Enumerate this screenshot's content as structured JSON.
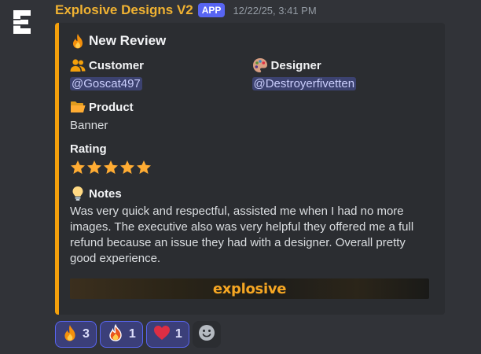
{
  "message": {
    "avatar_letter": "E",
    "author": "Explosive Designs V2",
    "app_tag": "APP",
    "timestamp": "12/22/25, 3:41 PM"
  },
  "embed": {
    "accent_color": "#f4a00b",
    "title": "New Review",
    "title_icon": "fire-icon",
    "fields": {
      "customer": {
        "label": "Customer",
        "icon": "people-icon",
        "value": "@Goscat497"
      },
      "designer": {
        "label": "Designer",
        "icon": "palette-icon",
        "value": "@Destroyerfivetten"
      },
      "product": {
        "label": "Product",
        "icon": "folder-icon",
        "value": "Banner"
      },
      "rating": {
        "label": "Rating",
        "stars": 5,
        "max_stars": 5
      },
      "notes": {
        "label": "Notes",
        "icon": "lightbulb-icon",
        "value": "Was very quick and respectful, assisted me when I had no more images. The executive also was very helpful they offered me a full refund because an issue they had with a designer. Overall pretty good experience."
      }
    },
    "banner_text": "explosive"
  },
  "reactions": [
    {
      "emoji": "fire-icon",
      "count": "3"
    },
    {
      "emoji": "flame-outline-icon",
      "count": "1"
    },
    {
      "emoji": "heart-icon",
      "count": "1"
    }
  ],
  "add_reaction_icon": "smiley-icon"
}
